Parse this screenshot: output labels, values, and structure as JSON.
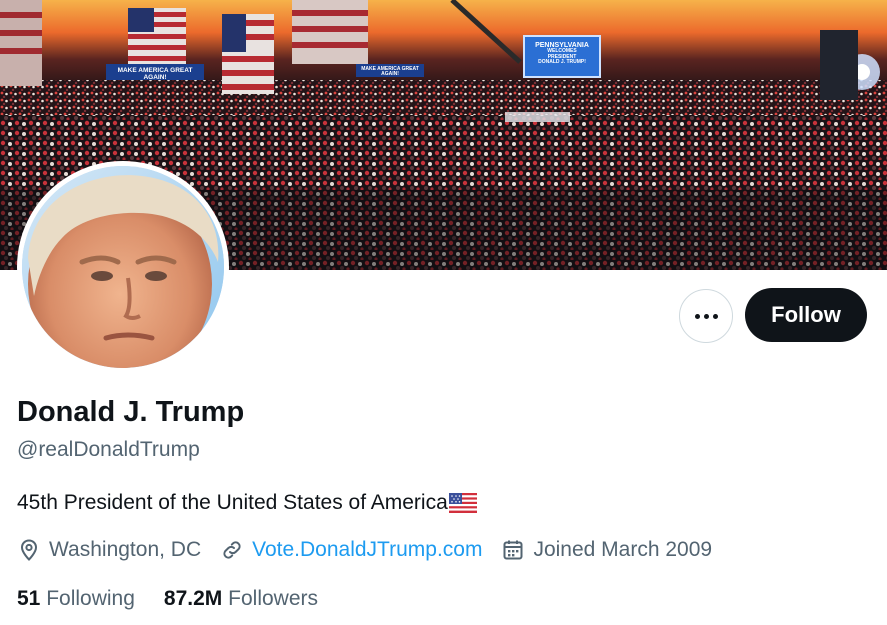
{
  "banner": {
    "sign_left": "MAKE AMERICA GREAT AGAIN!",
    "sign_mid": "MAKE AMERICA GREAT AGAIN!",
    "screen_line1": "PENNSYLVANIA",
    "screen_line2": "WELCOMES",
    "screen_line3": "PRESIDENT",
    "screen_line4": "DONALD J. TRUMP!"
  },
  "profile": {
    "display_name": "Donald J. Trump",
    "handle": "@realDonaldTrump",
    "bio": "45th President of the United States of America",
    "location": "Washington, DC",
    "website": "Vote.DonaldJTrump.com",
    "joined": "Joined March 2009"
  },
  "stats": {
    "following_count": "51",
    "following_label": "Following",
    "followers_count": "87.2M",
    "followers_label": "Followers"
  },
  "actions": {
    "follow_label": "Follow"
  },
  "icons": {
    "more": "more-dots-icon",
    "location": "location-pin-icon",
    "link": "link-icon",
    "calendar": "calendar-icon",
    "flag": "us-flag-emoji"
  },
  "colors": {
    "text_primary": "#0f1419",
    "text_secondary": "#536471",
    "link": "#1d9bf0",
    "follow_button": "#0f1419",
    "border": "#cfd9de"
  }
}
